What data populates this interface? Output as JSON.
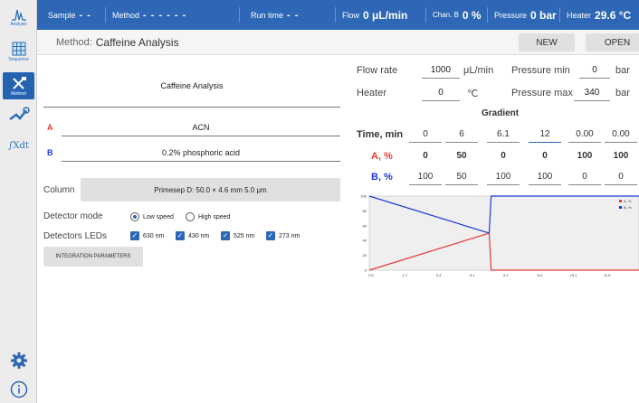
{
  "sidebar": {
    "items": [
      {
        "label": "Analysis",
        "icon": "peaks-icon"
      },
      {
        "label": "Sequence",
        "icon": "grid-icon"
      },
      {
        "label": "Method",
        "icon": "tools-icon"
      },
      {
        "label": "",
        "icon": "pump-wrench-icon"
      },
      {
        "label": "",
        "icon": "integral-icon",
        "text": "∫Xdt"
      }
    ],
    "bottom": [
      {
        "icon": "gear-icon"
      },
      {
        "icon": "info-icon"
      }
    ]
  },
  "status": {
    "sample_label": "Sample",
    "sample_value": "- -",
    "method_label": "Method",
    "method_value": "- - - - - -",
    "runtime_label": "Run time",
    "runtime_value": "- -",
    "flow_label": "Flow",
    "flow_value": "0 μL/min",
    "chanb_label": "Chan. B",
    "chanb_value": "0 %",
    "pressure_label": "Pressure",
    "pressure_value": "0 bar",
    "heater_label": "Heater",
    "heater_value": "29.6 °C"
  },
  "methodbar": {
    "label": "Method:",
    "name": "Caffeine Analysis",
    "new_label": "NEW",
    "open_label": "OPEN"
  },
  "left": {
    "method_name": "Caffeine Analysis",
    "solvent_a_letter": "A",
    "solvent_a": "ACN",
    "solvent_b_letter": "B",
    "solvent_b": "0.2% phosphoric acid",
    "column_label": "Column",
    "column_value": "Primesep D: 50.0 × 4.6 mm 5.0 μm",
    "detector_mode_label": "Detector mode",
    "mode_low": "Low speed",
    "mode_high": "High speed",
    "leds_label": "Detectors LEDs",
    "leds": [
      "630 nm",
      "430 nm",
      "525 nm",
      "273 nm"
    ],
    "integration_label": "INTEGRATION PARAMETERS"
  },
  "right": {
    "flow_rate_label": "Flow rate",
    "flow_rate_value": "1000",
    "flow_rate_unit": "μL/min",
    "pressure_min_label": "Pressure min",
    "pressure_min_value": "0",
    "pressure_min_unit": "bar",
    "heater_label": "Heater",
    "heater_value": "0",
    "heater_unit": "℃",
    "pressure_max_label": "Pressure max",
    "pressure_max_value": "340",
    "pressure_max_unit": "bar",
    "gradient_title": "Gradient",
    "time_label": "Time, min",
    "a_label": "A, %",
    "b_label": "B, %",
    "time": [
      "0",
      "6",
      "6.1",
      "12",
      "0.00",
      "0.00"
    ],
    "a": [
      "0",
      "50",
      "0",
      "0",
      "100",
      "100"
    ],
    "b": [
      "100",
      "50",
      "100",
      "100",
      "0",
      "0"
    ]
  },
  "colors": {
    "accent": "#2d67b5",
    "series_a": "#e53935",
    "series_b": "#1e3ad6"
  },
  "chart_data": {
    "type": "line",
    "x": [
      0,
      6,
      6.1,
      12
    ],
    "series": [
      {
        "name": "A, %",
        "color": "#e53935",
        "values": [
          0,
          50,
          0,
          0
        ]
      },
      {
        "name": "B, %",
        "color": "#1e3ad6",
        "values": [
          100,
          50,
          100,
          100
        ]
      }
    ],
    "xlim": [
      0,
      13.5
    ],
    "ylim": [
      0,
      100
    ],
    "xticks": [
      "0.0",
      "1.7",
      "3.4",
      "5.1",
      "6.7",
      "8.4",
      "10.1",
      "11.8"
    ],
    "yticks": [
      "0",
      "20",
      "40",
      "60",
      "80",
      "100"
    ],
    "legend": [
      "A, %",
      "B, %"
    ],
    "legend_position": "top-right",
    "grid": false
  }
}
